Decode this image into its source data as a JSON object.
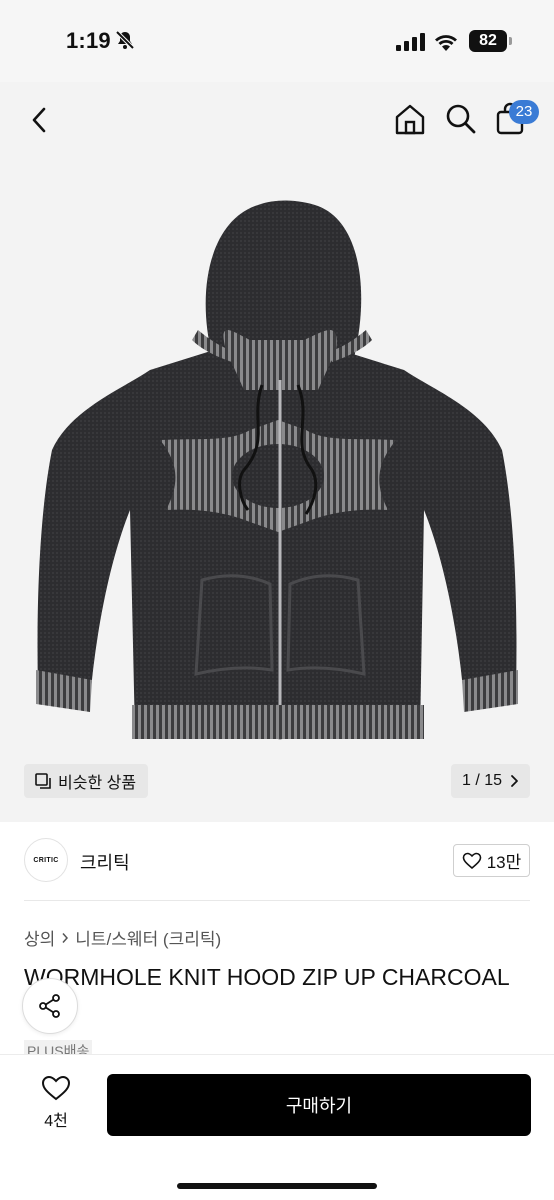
{
  "status_bar": {
    "time": "1:19",
    "battery": "82"
  },
  "nav": {
    "cart_count": "23"
  },
  "gallery": {
    "similar_label": "비슷한 상품",
    "page_indicator": "1 / 15"
  },
  "seller": {
    "logo_text": "CRITIC",
    "name": "크리틱",
    "likes": "13만"
  },
  "breadcrumb": {
    "category": "상의",
    "subcategory": "니트/스웨터 (크리틱)"
  },
  "product": {
    "title": "WORMHOLE KNIT HOOD ZIP UP CHARCOAL",
    "shipping_badge": "PLUS배송"
  },
  "bottom": {
    "wish_count": "4천",
    "buy_label": "구매하기"
  }
}
